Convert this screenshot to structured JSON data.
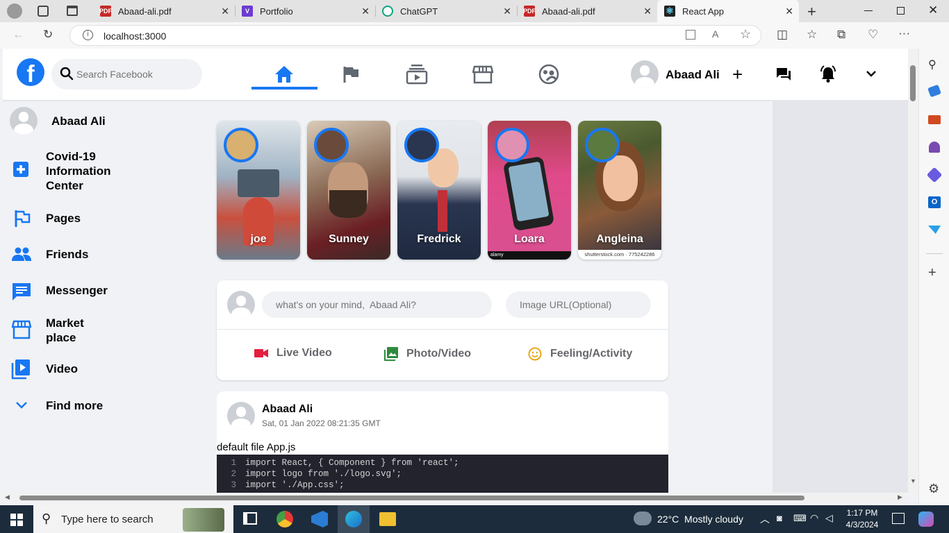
{
  "browser": {
    "tabs": [
      {
        "title": "Abaad-ali.pdf",
        "icon": "pdf-icon"
      },
      {
        "title": "Portfolio",
        "icon": "portfolio-icon"
      },
      {
        "title": "ChatGPT",
        "icon": "chatgpt-icon"
      },
      {
        "title": "Abaad-ali.pdf",
        "icon": "pdf-icon"
      },
      {
        "title": "React App",
        "icon": "react-icon"
      }
    ],
    "url": "localhost:3000"
  },
  "header": {
    "logo": "f",
    "search_placeholder": "Search Facebook",
    "user_name": "Abaad Ali"
  },
  "sidebar": {
    "profile_name": "Abaad Ali",
    "items": [
      {
        "label": "Covid-19 Information Center",
        "icon": "plus-square-icon"
      },
      {
        "label": "Pages",
        "icon": "flag-icon"
      },
      {
        "label": "Friends",
        "icon": "people-icon"
      },
      {
        "label": "Messenger",
        "icon": "chat-icon"
      },
      {
        "label": "Market place",
        "icon": "storefront-icon"
      },
      {
        "label": "Video",
        "icon": "video-library-icon"
      },
      {
        "label": "Find more",
        "icon": "chevron-down-icon"
      }
    ]
  },
  "stories": [
    {
      "name": "joe"
    },
    {
      "name": "Sunney"
    },
    {
      "name": "Fredrick"
    },
    {
      "name": "Loara"
    },
    {
      "name": "Angleina"
    }
  ],
  "story_watermarks": {
    "alamy": "alamy",
    "shutterstock": "shutterstock.com · 775242286"
  },
  "composer": {
    "message_placeholder": "what's on your mind,  Abaad Ali?",
    "image_placeholder": "Image URL(Optional)",
    "options": [
      {
        "label": "Live Video",
        "color": "#e41e3f"
      },
      {
        "label": "Photo/Video",
        "color": "#45bd62"
      },
      {
        "label": "Feeling/Activity",
        "color": "#f7b928"
      }
    ]
  },
  "post": {
    "author": "Abaad Ali",
    "timestamp": "Sat, 01 Jan 2022 08:21:35 GMT",
    "text": "default file App.js",
    "code_lines": [
      {
        "n": "1",
        "text": "import React, { Component } from 'react';"
      },
      {
        "n": "2",
        "text": "import logo from './logo.svg';"
      },
      {
        "n": "3",
        "text": "import './App.css';"
      }
    ]
  },
  "taskbar": {
    "search_placeholder": "Type here to search",
    "weather": "22°C  Mostly cloudy",
    "time": "1:17 PM",
    "date": "4/3/2024"
  },
  "colors": {
    "accent": "#1877f2",
    "background": "#f0f2f5"
  }
}
